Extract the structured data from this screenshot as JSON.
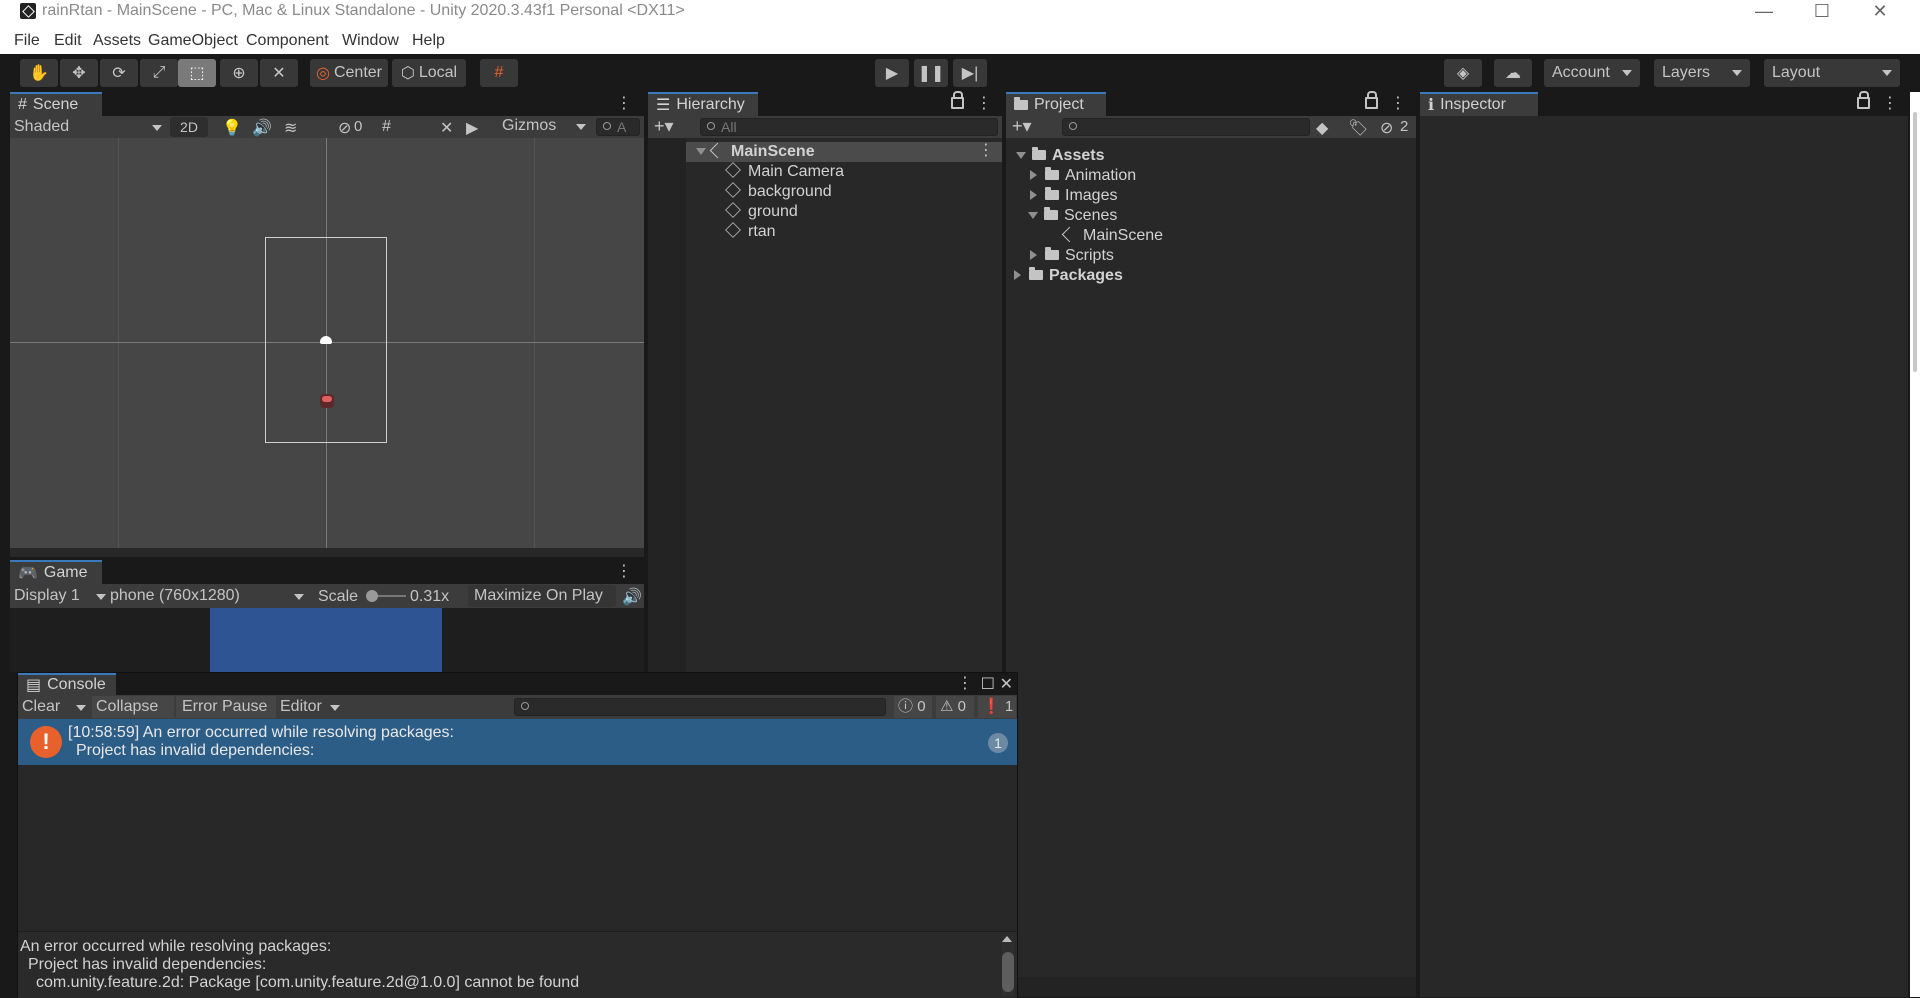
{
  "window": {
    "title": "rainRtan - MainScene - PC, Mac & Linux Standalone - Unity 2020.3.43f1 Personal <DX11>",
    "minimize": "—",
    "maximize": "☐",
    "close": "✕"
  },
  "menu": [
    "File",
    "Edit",
    "Assets",
    "GameObject",
    "Component",
    "Window",
    "Help"
  ],
  "toolbar": {
    "pivot": "Center",
    "space": "Local",
    "account": "Account",
    "layers": "Layers",
    "layout": "Layout"
  },
  "scene": {
    "tab": "Scene",
    "shading": "Shaded",
    "mode_2d": "2D",
    "hidden_count": "0",
    "gizmos": "Gizmos",
    "search_placeholder": "A"
  },
  "hierarchy": {
    "tab": "Hierarchy",
    "search_placeholder": "All",
    "scene_name": "MainScene",
    "objects": [
      "Main Camera",
      "background",
      "ground",
      "rtan"
    ]
  },
  "project": {
    "tab": "Project",
    "hidden_packages": "2",
    "assets": "Assets",
    "folders": [
      "Animation",
      "Images",
      "Scenes",
      "Scripts"
    ],
    "scene_file": "MainScene",
    "packages": "Packages"
  },
  "inspector": {
    "tab": "Inspector"
  },
  "game": {
    "tab": "Game",
    "display": "Display 1",
    "resolution": "phone (760x1280)",
    "scale_label": "Scale",
    "scale_value": "0.31x",
    "maximize": "Maximize On Play"
  },
  "console": {
    "tab": "Console",
    "clear": "Clear",
    "collapse": "Collapse",
    "error_pause": "Error Pause",
    "editor": "Editor",
    "log_count": "0",
    "warn_count": "0",
    "error_count": "1",
    "entry_line1": "[10:58:59] An error occurred while resolving packages:",
    "entry_line2": "Project has invalid dependencies:",
    "entry_count": "1",
    "detail_line1": "An error occurred while resolving packages:",
    "detail_line2": "Project has invalid dependencies:",
    "detail_line3": "com.unity.feature.2d: Package [com.unity.feature.2d@1.0.0] cannot be found",
    "colors": {
      "selected_row": "#2c5d87",
      "error": "#e8602c"
    }
  }
}
